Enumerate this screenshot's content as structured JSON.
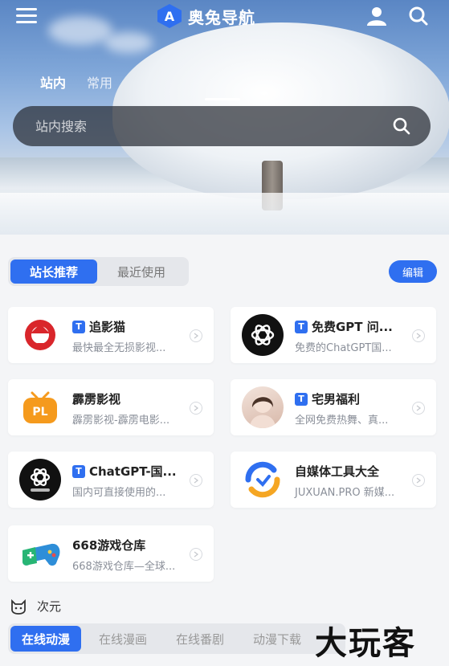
{
  "header": {
    "app_name": "奥兔导航",
    "logo_letter": "A",
    "icons": [
      "menu-icon",
      "user-icon",
      "search-icon"
    ]
  },
  "search": {
    "tabs": [
      "站内",
      "常用"
    ],
    "active_tab": "站内",
    "placeholder": "站内搜索"
  },
  "recommend": {
    "segments": [
      "站长推荐",
      "最近使用"
    ],
    "active_segment": "站长推荐",
    "edit_label": "编辑"
  },
  "cards": [
    {
      "title": "追影猫",
      "desc": "最快最全无损影视...",
      "tag": "T",
      "logo": "red-cat-logo",
      "color": "#d9262b"
    },
    {
      "title": "免费GPT 问...",
      "desc": "免费的ChatGPT国...",
      "tag": "T",
      "logo": "openai-logo",
      "color": "#111111"
    },
    {
      "title": "霹雳影视",
      "desc": "霹雳影视-霹雳电影...",
      "tag": "",
      "logo": "pl-tv-logo",
      "color": "#f59a1d"
    },
    {
      "title": "宅男福利",
      "desc": "全网免费热舞、真...",
      "tag": "T",
      "logo": "avatar-photo",
      "color": "#e8cfc4"
    },
    {
      "title": "ChatGPT-国...",
      "desc": "国内可直接使用的...",
      "tag": "T",
      "logo": "openai-logo-dark",
      "color": "#111111"
    },
    {
      "title": "自媒体工具大全",
      "desc": "JUXUAN.PRO 新媒...",
      "tag": "",
      "logo": "juxuan-logo",
      "color": "#f5a623"
    },
    {
      "title": "668游戏仓库",
      "desc": "668游戏仓库—全球...",
      "tag": "",
      "logo": "gamepad-logo",
      "color": "#2e8ed8"
    }
  ],
  "section": {
    "icon": "cat-face-icon",
    "title": "次元",
    "tabs": [
      "在线动漫",
      "在线漫画",
      "在线番剧",
      "动漫下载"
    ],
    "active_tab": "在线动漫"
  },
  "watermark": "大玩客",
  "colors": {
    "accent": "#2f6ff0"
  }
}
